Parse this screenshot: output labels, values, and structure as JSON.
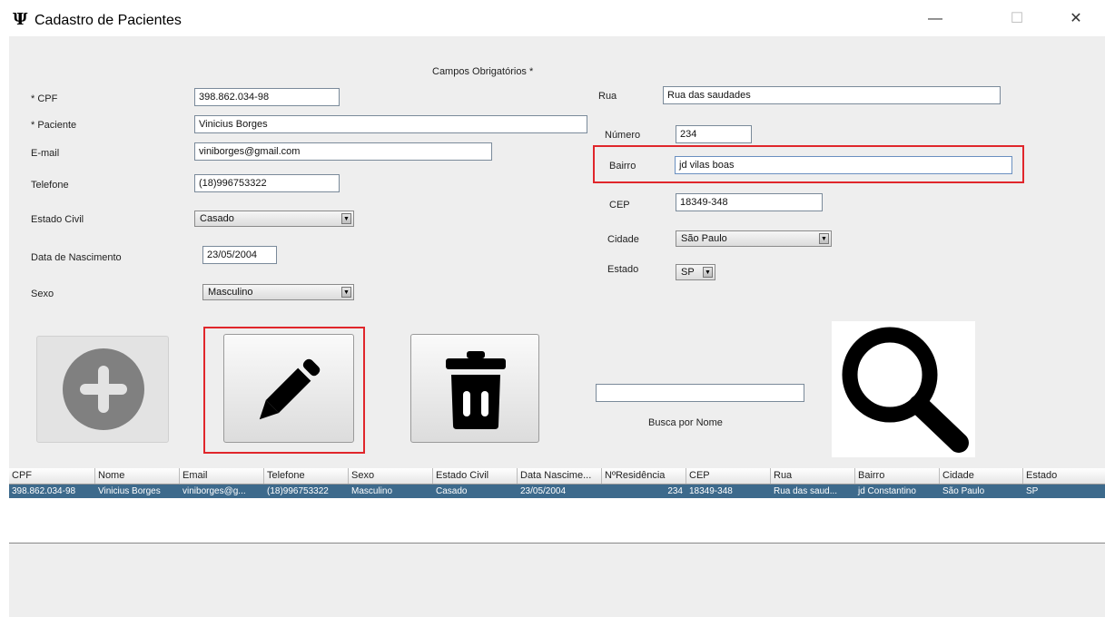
{
  "window": {
    "title": "Cadastro de Pacientes",
    "icon_glyph": "Ψ",
    "minimize": "—",
    "maximize": "☐",
    "close": "✕"
  },
  "form": {
    "required_note": "Campos Obrigatórios *",
    "cpf": {
      "label": "* CPF",
      "value": "398.862.034-98"
    },
    "paciente": {
      "label": "* Paciente",
      "value": "Vinicius Borges"
    },
    "email": {
      "label": "E-mail",
      "value": "viniborges@gmail.com"
    },
    "telefone": {
      "label": "Telefone",
      "value": "(18)996753322"
    },
    "estado_civil": {
      "label": "Estado Civil",
      "value": "Casado"
    },
    "nascimento": {
      "label": "Data de Nascimento",
      "value": "23/05/2004"
    },
    "sexo": {
      "label": "Sexo",
      "value": "Masculino"
    },
    "rua": {
      "label": "Rua",
      "value": "Rua das saudades"
    },
    "numero": {
      "label": "Número",
      "value": "234"
    },
    "bairro": {
      "label": "Bairro",
      "value": "jd vilas boas"
    },
    "cep": {
      "label": "CEP",
      "value": "18349-348"
    },
    "cidade": {
      "label": "Cidade",
      "value": "São Paulo"
    },
    "estado": {
      "label": "Estado",
      "value": "SP"
    }
  },
  "actions": {
    "add": {
      "icon": "plus-circle-icon",
      "enabled": false
    },
    "edit": {
      "icon": "pencil-icon",
      "enabled": true
    },
    "delete": {
      "icon": "trash-icon",
      "enabled": true
    },
    "search": {
      "icon": "magnifier-icon",
      "input_value": "",
      "label": "Busca por Nome"
    }
  },
  "table": {
    "columns": [
      "CPF",
      "Nome",
      "Email",
      "Telefone",
      "Sexo",
      "Estado Civil",
      "Data Nascime...",
      "NºResidência",
      "CEP",
      "Rua",
      "Bairro",
      "Cidade",
      "Estado"
    ],
    "rows": [
      [
        "398.862.034-98",
        "Vinicius Borges",
        "viniborges@g...",
        "(18)996753322",
        "Masculino",
        "Casado",
        "23/05/2004",
        "234",
        "18349-348",
        "Rua das saud...",
        "jd Constantino",
        "São Paulo",
        "SP"
      ]
    ]
  },
  "colors": {
    "highlight": "#e0262b",
    "selection": "#3d6a8c",
    "background": "#eeeeee"
  }
}
